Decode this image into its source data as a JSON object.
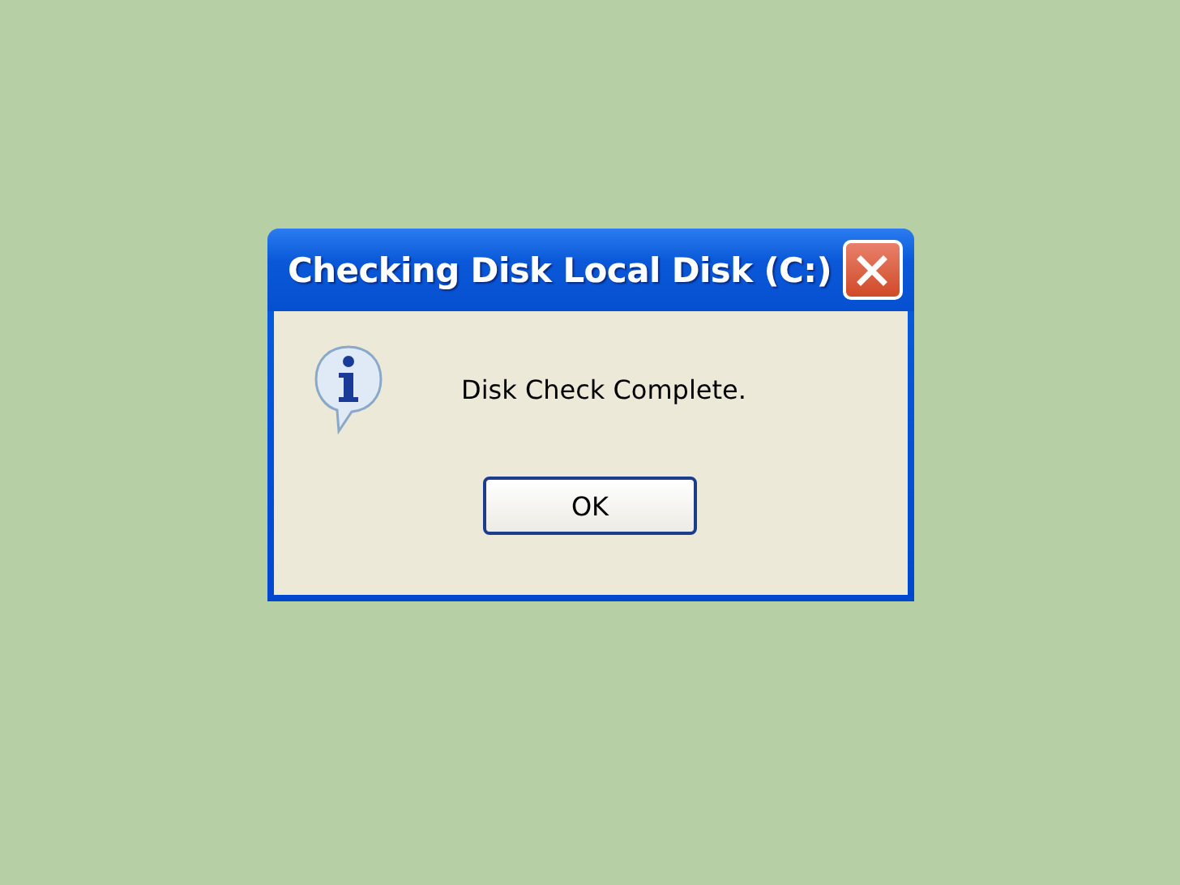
{
  "window": {
    "title": "Checking Disk Local Disk (C:)"
  },
  "message": "Disk Check Complete.",
  "buttons": [
    "OK"
  ]
}
